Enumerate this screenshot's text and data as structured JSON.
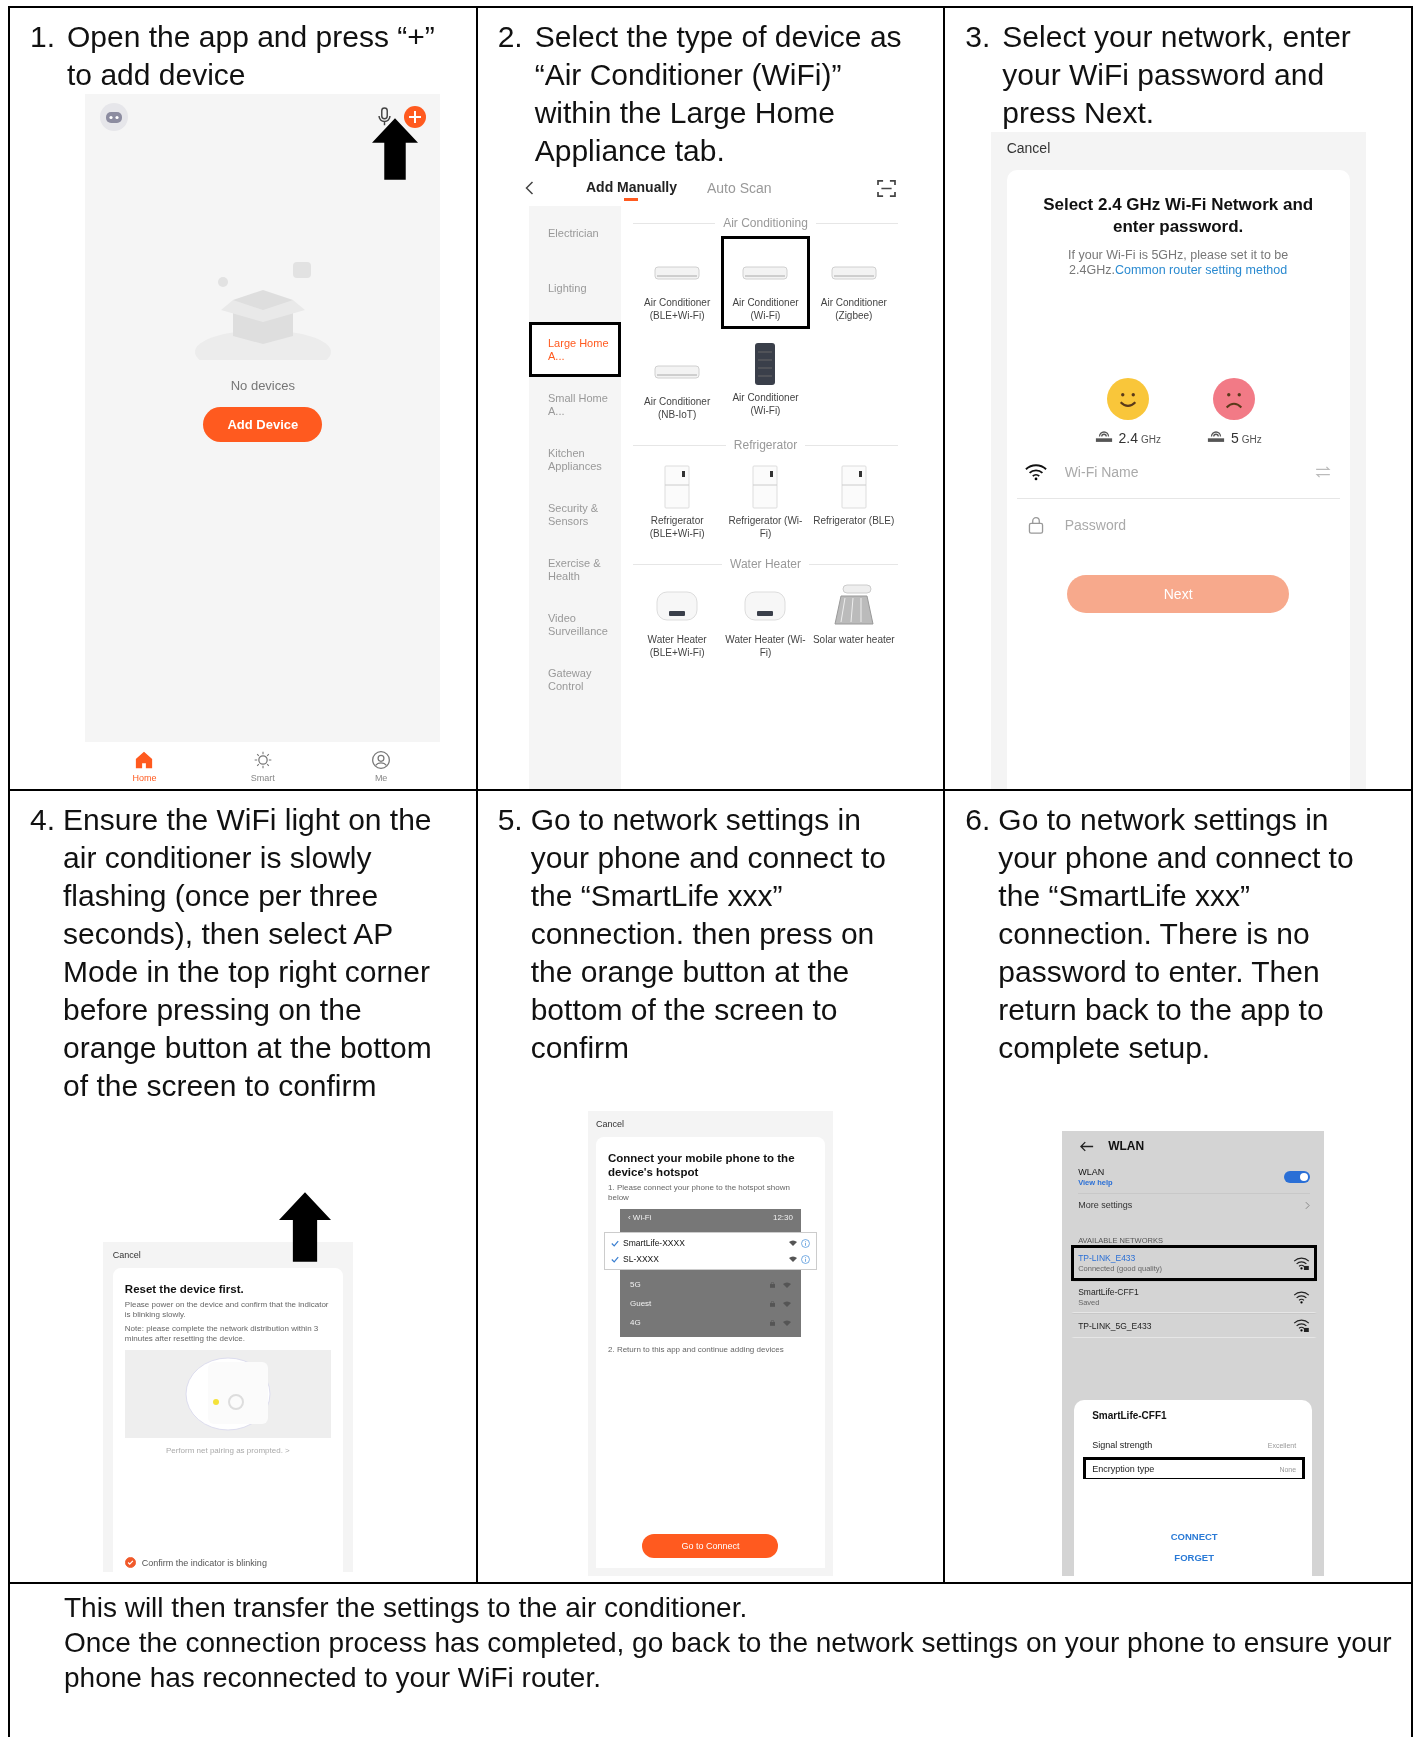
{
  "steps": [
    {
      "number": "1.",
      "caption": "Open the app and press “+” to add device",
      "screen": {
        "kind": "home",
        "empty_text": "No devices",
        "button": "Add Device",
        "nav": [
          {
            "label": "Home",
            "selected": true
          },
          {
            "label": "Smart",
            "selected": false
          },
          {
            "label": "Me",
            "selected": false
          }
        ]
      }
    },
    {
      "number": "2.",
      "caption": "Select the type of device as “Air Conditioner (WiFi)” within the Large Home Appliance tab.",
      "screen": {
        "kind": "catalog",
        "tabs": [
          {
            "label": "Add Manually",
            "selected": true
          },
          {
            "label": "Auto Scan",
            "selected": false
          }
        ],
        "categories": [
          {
            "label": "Electrician",
            "selected": false,
            "highlighted": false
          },
          {
            "label": "Lighting",
            "selected": false,
            "highlighted": false
          },
          {
            "label": "Large Home A...",
            "selected": true,
            "highlighted": true
          },
          {
            "label": "Small Home A...",
            "selected": false,
            "highlighted": false
          },
          {
            "label": "Kitchen Appliances",
            "selected": false,
            "highlighted": false
          },
          {
            "label": "Security & Sensors",
            "selected": false,
            "highlighted": false
          },
          {
            "label": "Exercise & Health",
            "selected": false,
            "highlighted": false
          },
          {
            "label": "Video Surveillance",
            "selected": false,
            "highlighted": false
          },
          {
            "label": "Gateway Control",
            "selected": false,
            "highlighted": false
          }
        ],
        "sections": [
          {
            "title": "Air Conditioning",
            "items": [
              {
                "kind": "ac",
                "name": "Air Conditioner (BLE+Wi-Fi)",
                "highlighted": false
              },
              {
                "kind": "ac",
                "name": "Air Conditioner (Wi-Fi)",
                "highlighted": true
              },
              {
                "kind": "ac",
                "name": "Air Conditioner (Zigbee)",
                "highlighted": false
              },
              {
                "kind": "ac",
                "name": "Air Conditioner (NB-IoT)",
                "highlighted": false
              },
              {
                "kind": "remote",
                "name": "Air Conditioner (Wi-Fi)",
                "highlighted": false
              }
            ]
          },
          {
            "title": "Refrigerator",
            "items": [
              {
                "kind": "fridge",
                "name": "Refrigerator (BLE+Wi-Fi)",
                "highlighted": false
              },
              {
                "kind": "fridge",
                "name": "Refrigerator (Wi-Fi)",
                "highlighted": false
              },
              {
                "kind": "fridge",
                "name": "Refrigerator (BLE)",
                "highlighted": false
              }
            ]
          },
          {
            "title": "Water Heater",
            "items": [
              {
                "kind": "heater",
                "name": "Water Heater (BLE+Wi-Fi)",
                "highlighted": false
              },
              {
                "kind": "heater",
                "name": "Water Heater (Wi-Fi)",
                "highlighted": false
              },
              {
                "kind": "solar",
                "name": "Solar water heater",
                "highlighted": false
              }
            ]
          }
        ]
      }
    },
    {
      "number": "3.",
      "caption": "Select your network, enter your WiFi password and press Next.",
      "screen": {
        "kind": "wifi_form",
        "cancel": "Cancel",
        "title": "Select 2.4 GHz Wi-Fi Network and enter password.",
        "hint": "If your Wi-Fi is 5GHz, please set it to be 2.4GHz.",
        "link": "Common router setting method",
        "bands": [
          {
            "value": "2.4",
            "unit": "GHz",
            "supported": true
          },
          {
            "value": "5",
            "unit": "GHz",
            "supported": false
          }
        ],
        "fields": [
          {
            "kind": "wifi",
            "placeholder": "Wi-Fi Name"
          },
          {
            "kind": "password",
            "placeholder": "Password"
          }
        ],
        "button": {
          "label": "Next",
          "disabled": true
        }
      }
    },
    {
      "number": "4.",
      "caption": "Ensure the WiFi light on the air conditioner is slowly flashing (once per three seconds), then select AP Mode in the top right corner before pressing on the orange button at the bottom of the screen to confirm",
      "screen": {
        "kind": "reset",
        "cancel": "Cancel",
        "title": "Reset the device first.",
        "body": [
          "Please power on the device and confirm that the indicator is blinking slowly.",
          "Note: please complete the network distribution within 3 minutes after resetting the device."
        ],
        "prompt": "Perform net pairing as prompted. >",
        "confirm": {
          "label": "Confirm the indicator is blinking",
          "checked": true
        }
      }
    },
    {
      "number": "5.",
      "caption": "Go to network settings in your phone and connect to the “SmartLife xxx” connection. then press on the orange button at the bottom of the screen to confirm",
      "screen": {
        "kind": "hotspot",
        "cancel": "Cancel",
        "title": "Connect your mobile phone to the device's hotspot",
        "step1": "1. Please connect your phone to the hotspot shown below",
        "illustration": {
          "back": "‹ Wi-Fi",
          "time": "12:30",
          "hotspots": [
            {
              "name": "SmartLife-XXXX",
              "checked": true
            },
            {
              "name": "SL-XXXX",
              "checked": true
            }
          ],
          "others": [
            "5G",
            "Guest",
            "4G"
          ]
        },
        "step2": "2. Return to this app and continue adding devices",
        "button": "Go to Connect"
      }
    },
    {
      "number": "6.",
      "caption": "Go to network settings in your phone and connect to the “SmartLife xxx” connection. There is no password to enter. Then return back to the app to complete setup.",
      "screen": {
        "kind": "wlan",
        "title": "WLAN",
        "wlan": {
          "label": "WLAN",
          "link": "View help",
          "on": true
        },
        "more": "More settings",
        "section": "AVAILABLE NETWORKS",
        "networks": [
          {
            "name": "TP-LINK_E433",
            "status": "Connected (good quality)",
            "connected": true,
            "secured": true,
            "highlighted": true
          },
          {
            "name": "SmartLife-CFF1",
            "status": "Saved",
            "connected": false,
            "secured": false,
            "highlighted": false
          },
          {
            "name": "TP-LINK_5G_E433",
            "connected": false,
            "secured": true,
            "highlighted": false
          }
        ],
        "dialog": {
          "title": "SmartLife-CFF1",
          "rows": [
            {
              "label": "Signal strength",
              "value": "Excellent",
              "highlighted": false
            },
            {
              "label": "Encryption type",
              "value": "None",
              "highlighted": true
            }
          ],
          "actions": [
            "CONNECT",
            "FORGET"
          ]
        }
      }
    }
  ],
  "notes": [
    "This will then transfer the settings to the air conditioner.",
    "Once the connection process has completed, go back to the network settings on your phone to ensure your phone has reconnected to your WiFi router."
  ]
}
